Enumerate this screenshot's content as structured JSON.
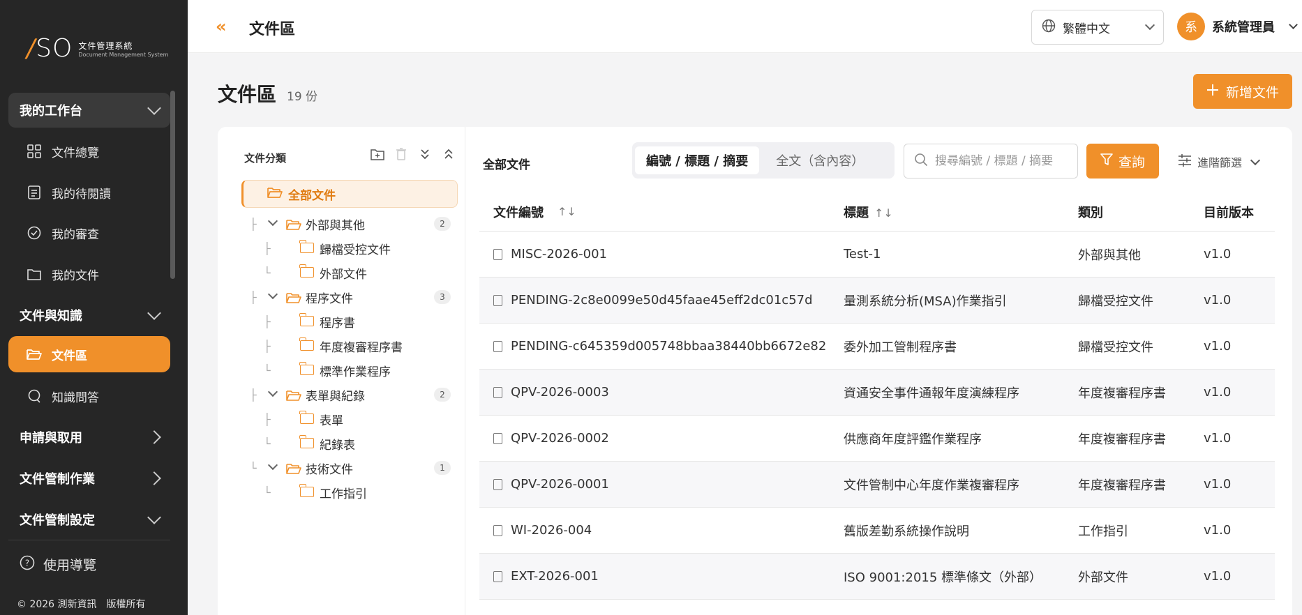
{
  "brand": {
    "mark_slash": "/",
    "mark_text": "SO",
    "name_zh": "文件管理系統",
    "name_en": "Document Management System"
  },
  "sidebar": {
    "sections": [
      {
        "label": "我的工作台",
        "expanded": true
      },
      {
        "label": "文件與知識",
        "expanded": true
      },
      {
        "label": "申請與取用",
        "expanded": false
      },
      {
        "label": "文件管制作業",
        "expanded": false
      },
      {
        "label": "文件管制設定",
        "expanded": true
      }
    ],
    "items": [
      {
        "label": "文件總覽",
        "icon": "grid-icon"
      },
      {
        "label": "我的待閱讀",
        "icon": "reading-list-icon"
      },
      {
        "label": "我的審查",
        "icon": "check-circle-icon"
      },
      {
        "label": "我的文件",
        "icon": "folder-icon"
      },
      {
        "label": "文件區",
        "icon": "folder-open-icon",
        "active": true
      },
      {
        "label": "知識問答",
        "icon": "chat-icon"
      }
    ],
    "help_label": "使用導覽",
    "copyright": "© 2026 測新資訊　版權所有"
  },
  "topbar": {
    "collapse_glyph": "«",
    "title": "文件區",
    "language": "繁體中文",
    "user_initial": "系",
    "user_name": "系統管理員"
  },
  "page": {
    "title": "文件區",
    "count": "19 份",
    "new_button": "新增文件"
  },
  "tree": {
    "title": "文件分類",
    "all_label": "全部文件",
    "nodes": [
      {
        "label": "外部與其他",
        "level": 0,
        "count": "2"
      },
      {
        "label": "歸檔受控文件",
        "level": 1
      },
      {
        "label": "外部文件",
        "level": 1
      },
      {
        "label": "程序文件",
        "level": 0,
        "count": "3"
      },
      {
        "label": "程序書",
        "level": 1
      },
      {
        "label": "年度複審程序書",
        "level": 1
      },
      {
        "label": "標準作業程序",
        "level": 1
      },
      {
        "label": "表單與紀錄",
        "level": 0,
        "count": "2"
      },
      {
        "label": "表單",
        "level": 1
      },
      {
        "label": "紀錄表",
        "level": 1
      },
      {
        "label": "技術文件",
        "level": 0,
        "count": "1"
      },
      {
        "label": "工作指引",
        "level": 1
      }
    ]
  },
  "content": {
    "title": "全部文件",
    "modes": [
      "編號 / 標題 / 摘要",
      "全文（含內容）"
    ],
    "search_placeholder": "搜尋編號 / 標題 / 摘要",
    "query_button": "查詢",
    "advanced_filter": "進階篩選"
  },
  "table": {
    "headers": [
      "文件編號",
      "標題",
      "類別",
      "目前版本"
    ],
    "sort_glyph": "↑↓",
    "rows": [
      {
        "code": "MISC-2026-001",
        "title": "Test-1",
        "category": "外部與其他",
        "version": "v1.0"
      },
      {
        "code": "PENDING-2c8e0099e50d45faae45eff2dc01c57d",
        "title": "量測系統分析(MSA)作業指引",
        "category": "歸檔受控文件",
        "version": "v1.0"
      },
      {
        "code": "PENDING-c645359d005748bbaa38440bb6672e82",
        "title": "委外加工管制程序書",
        "category": "歸檔受控文件",
        "version": "v1.0"
      },
      {
        "code": "QPV-2026-0003",
        "title": "資通安全事件通報年度演練程序",
        "category": "年度複審程序書",
        "version": "v1.0"
      },
      {
        "code": "QPV-2026-0002",
        "title": "供應商年度評鑑作業程序",
        "category": "年度複審程序書",
        "version": "v1.0"
      },
      {
        "code": "QPV-2026-0001",
        "title": "文件管制中心年度作業複審程序",
        "category": "年度複審程序書",
        "version": "v1.0"
      },
      {
        "code": "WI-2026-004",
        "title": "舊版差勤系統操作說明",
        "category": "工作指引",
        "version": "v1.0"
      },
      {
        "code": "EXT-2026-001",
        "title": "ISO 9001:2015 標準條文（外部）",
        "category": "外部文件",
        "version": "v1.0"
      }
    ]
  },
  "colors": {
    "accent": "#f0902a",
    "sidebar_bg": "#262626"
  }
}
